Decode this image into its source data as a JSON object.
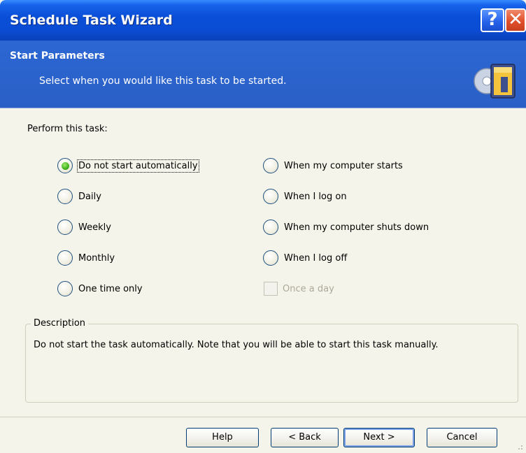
{
  "window": {
    "title": "Schedule Task Wizard",
    "help_glyph": "?",
    "close_glyph": "✕"
  },
  "header": {
    "title": "Start Parameters",
    "subtitle": "Select when you would like this task to be started.",
    "icon": "schedule-wizard-icon"
  },
  "perform": {
    "label": "Perform this task:",
    "selected": "Do not start automatically",
    "left_options": [
      "Do not start automatically",
      "Daily",
      "Weekly",
      "Monthly",
      "One time only"
    ],
    "right_options": [
      "When my computer starts",
      "When I log on",
      "When my computer shuts down",
      "When I log off"
    ],
    "once_a_day": {
      "label": "Once a day",
      "enabled": false,
      "checked": false
    }
  },
  "description": {
    "legend": "Description",
    "text": "Do not start the task automatically. Note that you will be able to start this task manually."
  },
  "buttons": {
    "help": "Help",
    "back": "< Back",
    "next": "Next >",
    "cancel": "Cancel"
  },
  "colors": {
    "title_bar": "#0b4cd4",
    "header_band": "#2a5fc6",
    "dialog_face": "#f5f4ea",
    "radio_checked": "#3fb21c",
    "close_button": "#e0502a"
  }
}
